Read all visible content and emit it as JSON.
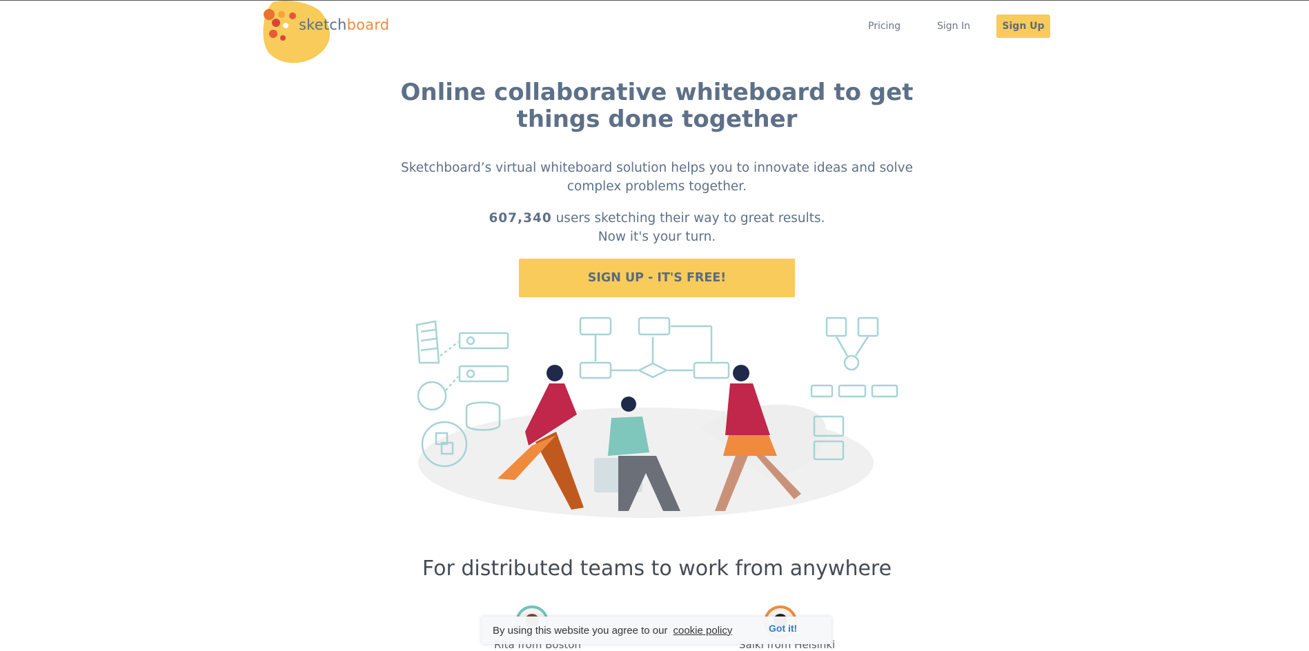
{
  "header": {
    "logo_text_a": "sketch",
    "logo_text_b": "board",
    "nav": {
      "pricing": "Pricing",
      "sign_in": "Sign In",
      "sign_up": "Sign Up"
    }
  },
  "hero": {
    "title_line1": "Online collaborative whiteboard to get",
    "title_line2": "things done together",
    "subtitle_line1": "Sketchboard’s virtual whiteboard solution helps you to innovate ideas and solve",
    "subtitle_line2": "complex problems together.",
    "user_count": "607,340",
    "users_text": " users sketching their way to great results.",
    "turn_text": "Now it's your turn.",
    "cta_label": "SIGN UP - IT'S FREE!"
  },
  "features": {
    "title": "For distributed teams to work from anywhere",
    "testimonials": [
      {
        "name": "Rita from Boston"
      },
      {
        "name": "Saiki from Helsinki"
      }
    ]
  },
  "cookie_banner": {
    "text": "By using this website you agree to our",
    "link": "cookie policy",
    "button": "Got it!"
  },
  "colors": {
    "accent_yellow": "#f8cb5a",
    "brand_orange": "#f08a3c",
    "text_slate": "#5d7088",
    "line_teal": "#a7d3d6"
  }
}
